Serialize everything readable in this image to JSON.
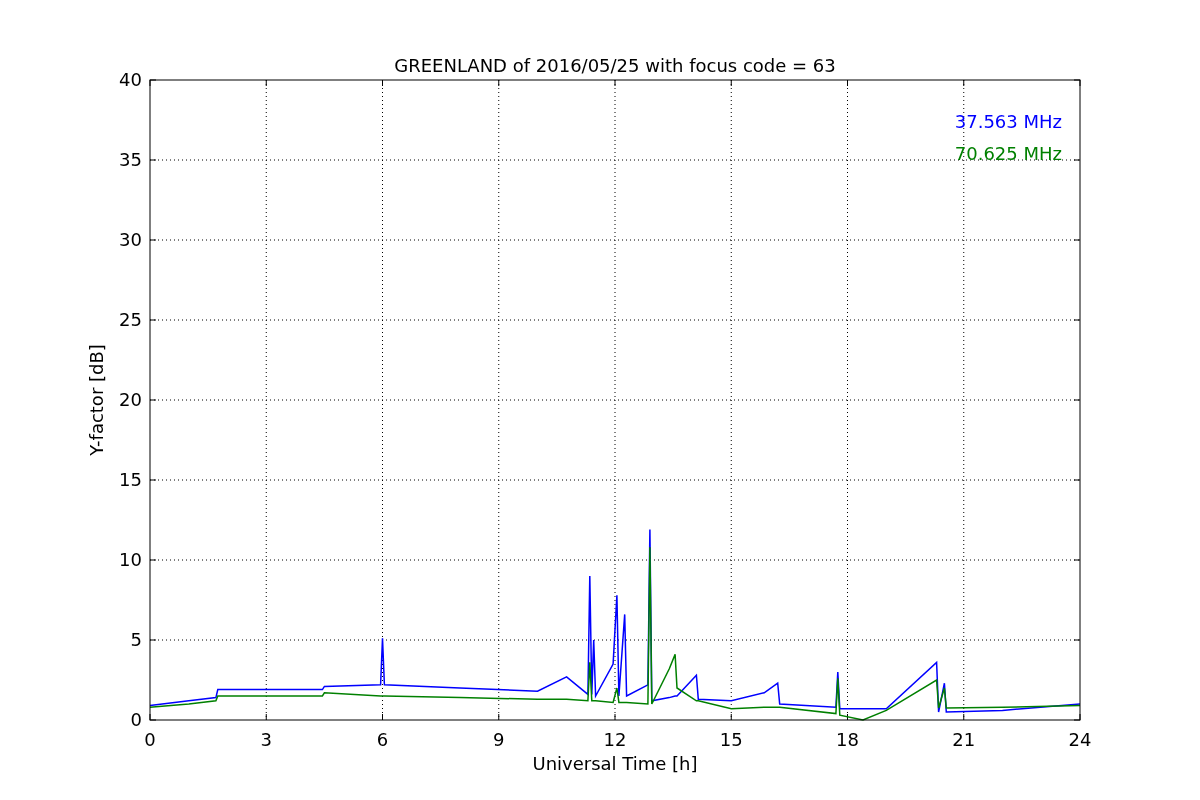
{
  "figure": {
    "chart_data": {
      "type": "line",
      "title": "GREENLAND of 2016/05/25 with focus code = 63",
      "xlabel": "Universal Time [h]",
      "ylabel": "Y-factor [dB]",
      "x": [
        0,
        1,
        1.7,
        1.75,
        4.45,
        4.5,
        5.95,
        6,
        6.05,
        8,
        10,
        10.75,
        11.3,
        11.35,
        11.4,
        11.45,
        11.5,
        11.95,
        12.05,
        12.1,
        12.25,
        12.3,
        12.85,
        12.9,
        12.95,
        13.4,
        13.55,
        13.6,
        14.1,
        14.15,
        15,
        15.85,
        16.2,
        16.25,
        17.7,
        17.75,
        17.8,
        18.4,
        19,
        20.3,
        20.35,
        20.5,
        20.55,
        22,
        24
      ],
      "series": [
        {
          "name": "37.563 MHz",
          "color": "#0000ff",
          "values": [
            0.9,
            1.2,
            1.4,
            1.9,
            1.9,
            2.1,
            2.2,
            5.1,
            2.2,
            2.0,
            1.8,
            2.7,
            1.6,
            9.0,
            1.6,
            5.0,
            1.5,
            3.5,
            7.8,
            1.5,
            6.6,
            1.5,
            2.2,
            11.9,
            1.2,
            1.4,
            1.5,
            1.5,
            2.8,
            1.3,
            1.2,
            1.7,
            2.3,
            1.0,
            0.8,
            3.0,
            0.7,
            0.7,
            0.7,
            3.6,
            0.5,
            2.3,
            0.5,
            0.6,
            1.0
          ]
        },
        {
          "name": "70.625 MHz",
          "color": "#008000",
          "values": [
            0.8,
            1.0,
            1.2,
            1.5,
            1.5,
            1.7,
            1.5,
            1.5,
            1.5,
            1.4,
            1.3,
            1.3,
            1.2,
            3.6,
            1.2,
            1.2,
            1.2,
            1.1,
            2.0,
            1.1,
            1.1,
            1.1,
            1.0,
            10.8,
            1.0,
            3.2,
            4.1,
            2.0,
            1.2,
            1.2,
            0.7,
            0.8,
            0.8,
            0.8,
            0.4,
            2.6,
            0.3,
            0.0,
            0.6,
            2.5,
            0.75,
            2.0,
            0.75,
            0.8,
            0.9
          ]
        }
      ],
      "xlim": [
        0,
        24
      ],
      "ylim": [
        0,
        40
      ],
      "xticks": [
        0,
        3,
        6,
        9,
        12,
        15,
        18,
        21,
        24
      ],
      "yticks": [
        0,
        5,
        10,
        15,
        20,
        25,
        30,
        35,
        40
      ],
      "grid": true
    }
  }
}
